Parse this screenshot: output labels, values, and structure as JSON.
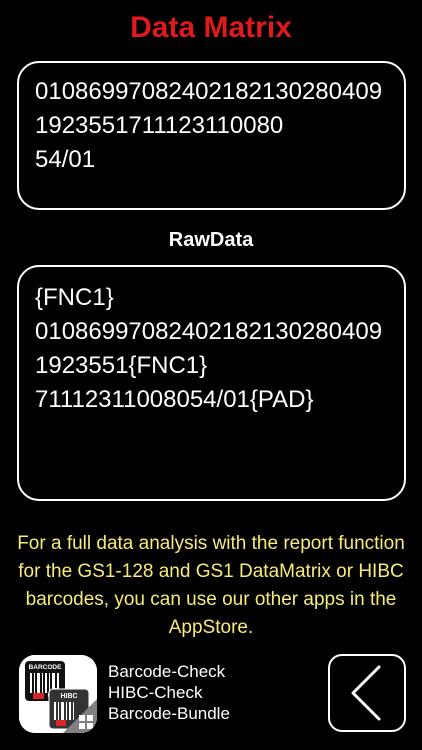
{
  "header": {
    "title": "Data Matrix"
  },
  "decoded": {
    "text": "010869970824021821302804091923551711123110080\n54/01"
  },
  "rawdata": {
    "label": "RawData",
    "text": "{FNC1}\n010869970824021821302804091923551{FNC1}\n71112311008054/01{PAD}"
  },
  "info": {
    "text": "For a full data analysis with the report function for the GS1-128 and GS1 DataMatrix or HIBC barcodes, you can use our other apps in the AppStore."
  },
  "apps": {
    "icon_top_label": "BARCODE",
    "icon_bottom_label": "HIBC",
    "links": [
      "Barcode-Check",
      "HIBC-Check",
      "Barcode-Bundle"
    ]
  },
  "colors": {
    "title": "#e0191c",
    "info_text": "#f5ec7a",
    "background": "#000000",
    "border": "#ffffff"
  },
  "icons": {
    "back": "chevron-left-icon",
    "app": "barcode-bundle-app-icon"
  }
}
